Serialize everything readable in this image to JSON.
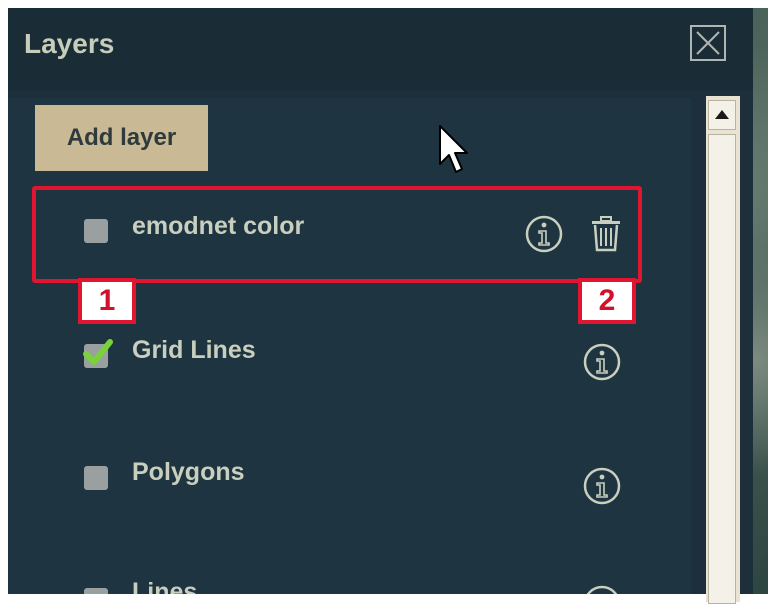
{
  "panel": {
    "title": "Layers",
    "close_icon": "close-icon"
  },
  "add_layer_label": "Add layer",
  "layers": [
    {
      "label": "emodnet color",
      "checked": false,
      "info_icon": "info-icon",
      "delete_icon": "trash-icon"
    },
    {
      "label": "Grid Lines",
      "checked": true,
      "info_icon": "info-icon"
    },
    {
      "label": "Polygons",
      "checked": false,
      "info_icon": "info-icon"
    },
    {
      "label": "Lines",
      "checked": false,
      "info_icon": "info-icon"
    }
  ],
  "annotations": {
    "marker_1": "1",
    "marker_2": "2",
    "highlight_color": "#e0152f"
  },
  "colors": {
    "panel_bg": "#1c2f3a",
    "add_button_bg": "#c9b994",
    "checkbox_checked": "#7bd13c"
  }
}
